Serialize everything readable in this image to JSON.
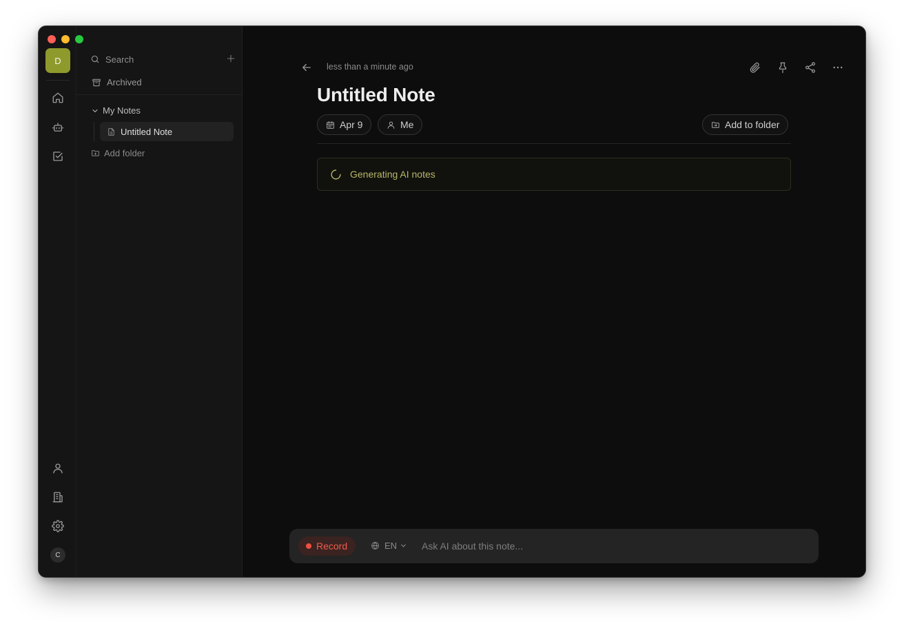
{
  "window": {
    "traffic_lights": [
      "close",
      "minimize",
      "maximize"
    ]
  },
  "rail": {
    "workspace_initial": "D",
    "top_icons": [
      "home-icon",
      "bot-icon",
      "check-square-icon"
    ],
    "bottom_icons": [
      "user-icon",
      "building-icon",
      "gear-icon"
    ],
    "user_initial": "C"
  },
  "sidebar": {
    "search_label": "Search",
    "archived_label": "Archived",
    "folder_label": "My Notes",
    "folder_expanded": true,
    "notes": [
      {
        "label": "Untitled Note",
        "active": true
      }
    ],
    "add_folder_label": "Add folder"
  },
  "note": {
    "back_icon": "arrow-left-icon",
    "updated_text": "less than a minute ago",
    "toolbar_icons": [
      "paperclip-icon",
      "pin-icon",
      "share-icon",
      "more-icon"
    ],
    "title": "Untitled Note",
    "date_chip": "Apr 9",
    "owner_chip": "Me",
    "add_to_folder_label": "Add to folder",
    "status_text": "Generating AI notes"
  },
  "askbar": {
    "record_label": "Record",
    "language": "EN",
    "input_value": "",
    "input_placeholder": "Ask AI about this note..."
  },
  "colors": {
    "workspace_avatar": "#8f9a2c",
    "record_accent": "#ef4f3f",
    "status_accent": "#b9b66c"
  }
}
